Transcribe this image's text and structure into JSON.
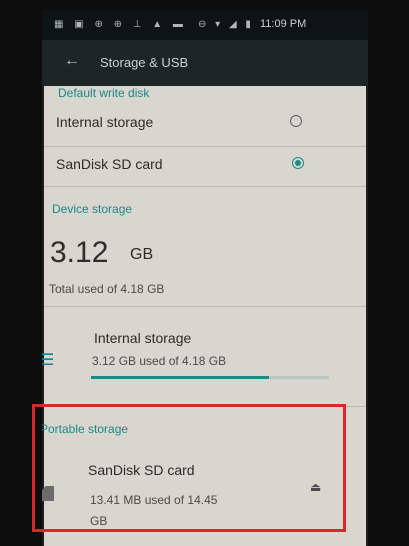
{
  "status_bar": {
    "left_icons": "▦ ▣ ⊕ ⊕ ⊥ ▲ ▬",
    "right_icons": "⊖ ▾ ◢ ▮",
    "time": "11:09 PM"
  },
  "toolbar": {
    "back_icon": "arrow-back-icon",
    "title": "Storage & USB"
  },
  "default_write_disk": {
    "label": "Default write disk",
    "options": [
      {
        "label": "Internal storage",
        "selected": false
      },
      {
        "label": "SanDisk SD card",
        "selected": true
      }
    ]
  },
  "device_storage": {
    "label": "Device storage",
    "used_value": "3.12",
    "used_unit": "GB",
    "total_text": "Total used of 4.18 GB",
    "internal": {
      "title": "Internal storage",
      "usage": "3.12 GB used of 4.18 GB",
      "fraction_used": 0.746
    }
  },
  "portable_storage": {
    "label": "Portable storage",
    "sd": {
      "title": "SanDisk SD card",
      "usage_line1": "13.41 MB used of 14.45",
      "usage_line2": "GB"
    }
  },
  "colors": {
    "accent": "#1a8a86",
    "highlight": "#d8262b"
  }
}
